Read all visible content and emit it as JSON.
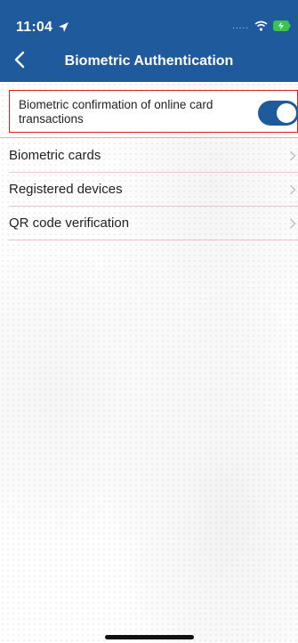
{
  "status_bar": {
    "time": "11:04",
    "dots": "....."
  },
  "nav": {
    "title": "Biometric Authentication"
  },
  "toggle": {
    "label": "Biometric confirmation of online card transactions",
    "enabled": true
  },
  "list": {
    "items": [
      {
        "label": "Biometric cards"
      },
      {
        "label": "Registered devices"
      },
      {
        "label": "QR code verification"
      }
    ]
  },
  "colors": {
    "primary": "#1f5a9d",
    "highlight_border": "#e0201f"
  },
  "icons": {
    "back": "chevron-left-icon",
    "item": "chevron-right-icon"
  }
}
